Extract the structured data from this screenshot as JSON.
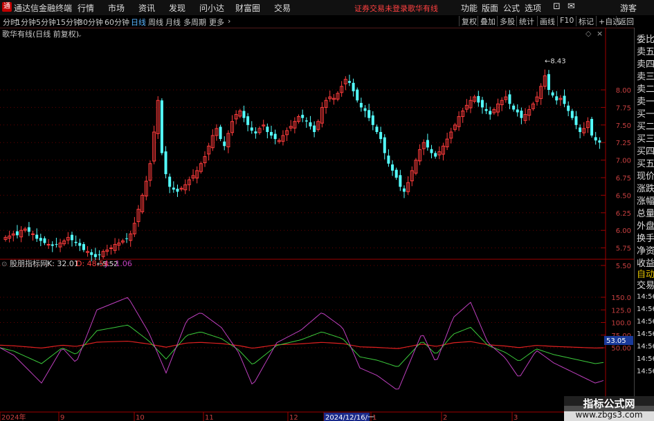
{
  "titlebar": {
    "app_name": "通达信金融终端",
    "menus": [
      "行情",
      "市场",
      "资讯",
      "发现",
      "问小达",
      "财富圈",
      "交易"
    ],
    "status": "证券交易未登录",
    "stock_name": "歌华有线",
    "right_menus": [
      "功能",
      "版面",
      "公式",
      "选项"
    ],
    "guest": "游客"
  },
  "toolbar": {
    "periods": [
      "分时",
      "1分钟",
      "5分钟",
      "15分钟",
      "30分钟",
      "60分钟",
      "日线",
      "周线",
      "月线",
      "多周期",
      "更多"
    ],
    "active": "日线",
    "right_buttons": [
      "复权",
      "叠加",
      "多股",
      "统计",
      "画线",
      "F10",
      "标记",
      "+自选",
      "返回"
    ]
  },
  "main_chart": {
    "label": "歌华有线(日线 前复权)",
    "high_label": "8.43",
    "low_label": "5.52",
    "y_ticks": [
      "8.00",
      "7.75",
      "7.50",
      "7.25",
      "7.00",
      "6.75",
      "6.50",
      "6.25",
      "6.00",
      "5.75",
      "5.50"
    ]
  },
  "indicator": {
    "name": "股朋指标网",
    "k_label": "K: 32.01",
    "d_label": "D: 48.54",
    "j_label": "J: -1.06",
    "y_ticks": [
      "150.0",
      "125.0",
      "100.0",
      "75.00",
      "50.00"
    ],
    "current_tag": "53.05"
  },
  "x_axis": {
    "labels": [
      "2024年",
      "9",
      "10",
      "11",
      "12",
      "2024/12/16/一",
      "1",
      "2",
      "3"
    ]
  },
  "right_panel": {
    "items": [
      "委比",
      "卖五",
      "卖四",
      "卖三",
      "卖二",
      "卖一",
      "买一",
      "买二",
      "买三",
      "买四",
      "买五",
      "现价",
      "涨跌",
      "涨幅",
      "总量",
      "外盘",
      "换手",
      "净资",
      "收益"
    ],
    "auto_label": "自动",
    "trade_label": "交易",
    "time_labels": [
      "14:56",
      "14:56",
      "14:56",
      "14:56",
      "14:56",
      "14:56",
      "14:56"
    ]
  },
  "watermark": {
    "title": "指标公式网",
    "url": "www.zbgs3.com"
  },
  "colors": {
    "up": "#ff3c3c",
    "down": "#54ffff",
    "k_line": "#d8d8d8",
    "d_line": "#3ccc3c",
    "j_line": "#c040c0",
    "ma_red": "#e02020",
    "grid": "#6b0000"
  }
}
